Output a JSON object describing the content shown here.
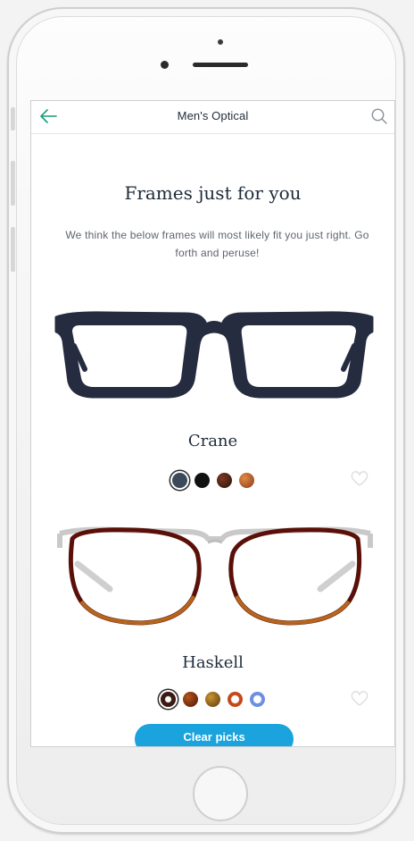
{
  "nav": {
    "title": "Men's Optical",
    "back_icon": "arrow-left-icon",
    "search_icon": "search-icon",
    "accent_color": "#1a9c7a"
  },
  "hero": {
    "title": "Frames just for you",
    "subtitle": "We think the below frames will most likely fit you just right. Go forth and peruse!"
  },
  "frames": [
    {
      "name": "Crane",
      "swatches": [
        "#3b4a5a",
        "#111111",
        "#3a1a12",
        "#b5652e"
      ],
      "selected_swatch": 0,
      "favorite_icon": "heart-icon"
    },
    {
      "name": "Haskell",
      "swatches": [
        "#3a1a12",
        "#7a3410",
        "#9a6a2a",
        "#c24a1a",
        "#6d8fe0"
      ],
      "selected_swatch": 0,
      "favorite_icon": "heart-icon"
    }
  ],
  "footer": {
    "clear_label": "Clear picks",
    "button_color": "#1aa3dc"
  }
}
